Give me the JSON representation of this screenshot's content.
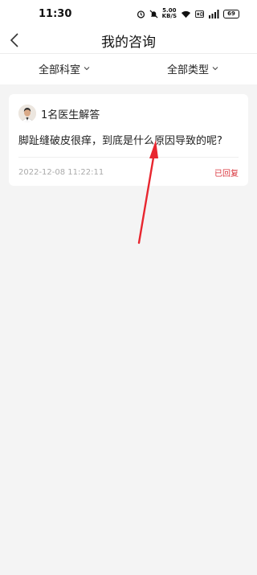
{
  "status_bar": {
    "time": "11:30",
    "speed_value": "5.00",
    "speed_unit": "KB/S",
    "battery": "69",
    "icons": [
      "alarm-icon",
      "mute-icon",
      "wifi-icon",
      "hd-icon",
      "signal-icon",
      "battery-icon"
    ]
  },
  "nav": {
    "title": "我的咨询",
    "back_icon": "chevron-left-icon"
  },
  "filters": [
    {
      "label": "全部科室",
      "icon": "chevron-down-icon"
    },
    {
      "label": "全部类型",
      "icon": "chevron-down-icon"
    }
  ],
  "consultation": {
    "doctor_count_text": "1名医生解答",
    "question": "脚趾缝破皮很痒，到底是什么原因导致的呢?",
    "timestamp": "2022-12-08 11:22:11",
    "status": "已回复",
    "status_color": "#d9363e"
  },
  "colors": {
    "annotation_arrow": "#e8262f",
    "background": "#f4f4f4"
  }
}
